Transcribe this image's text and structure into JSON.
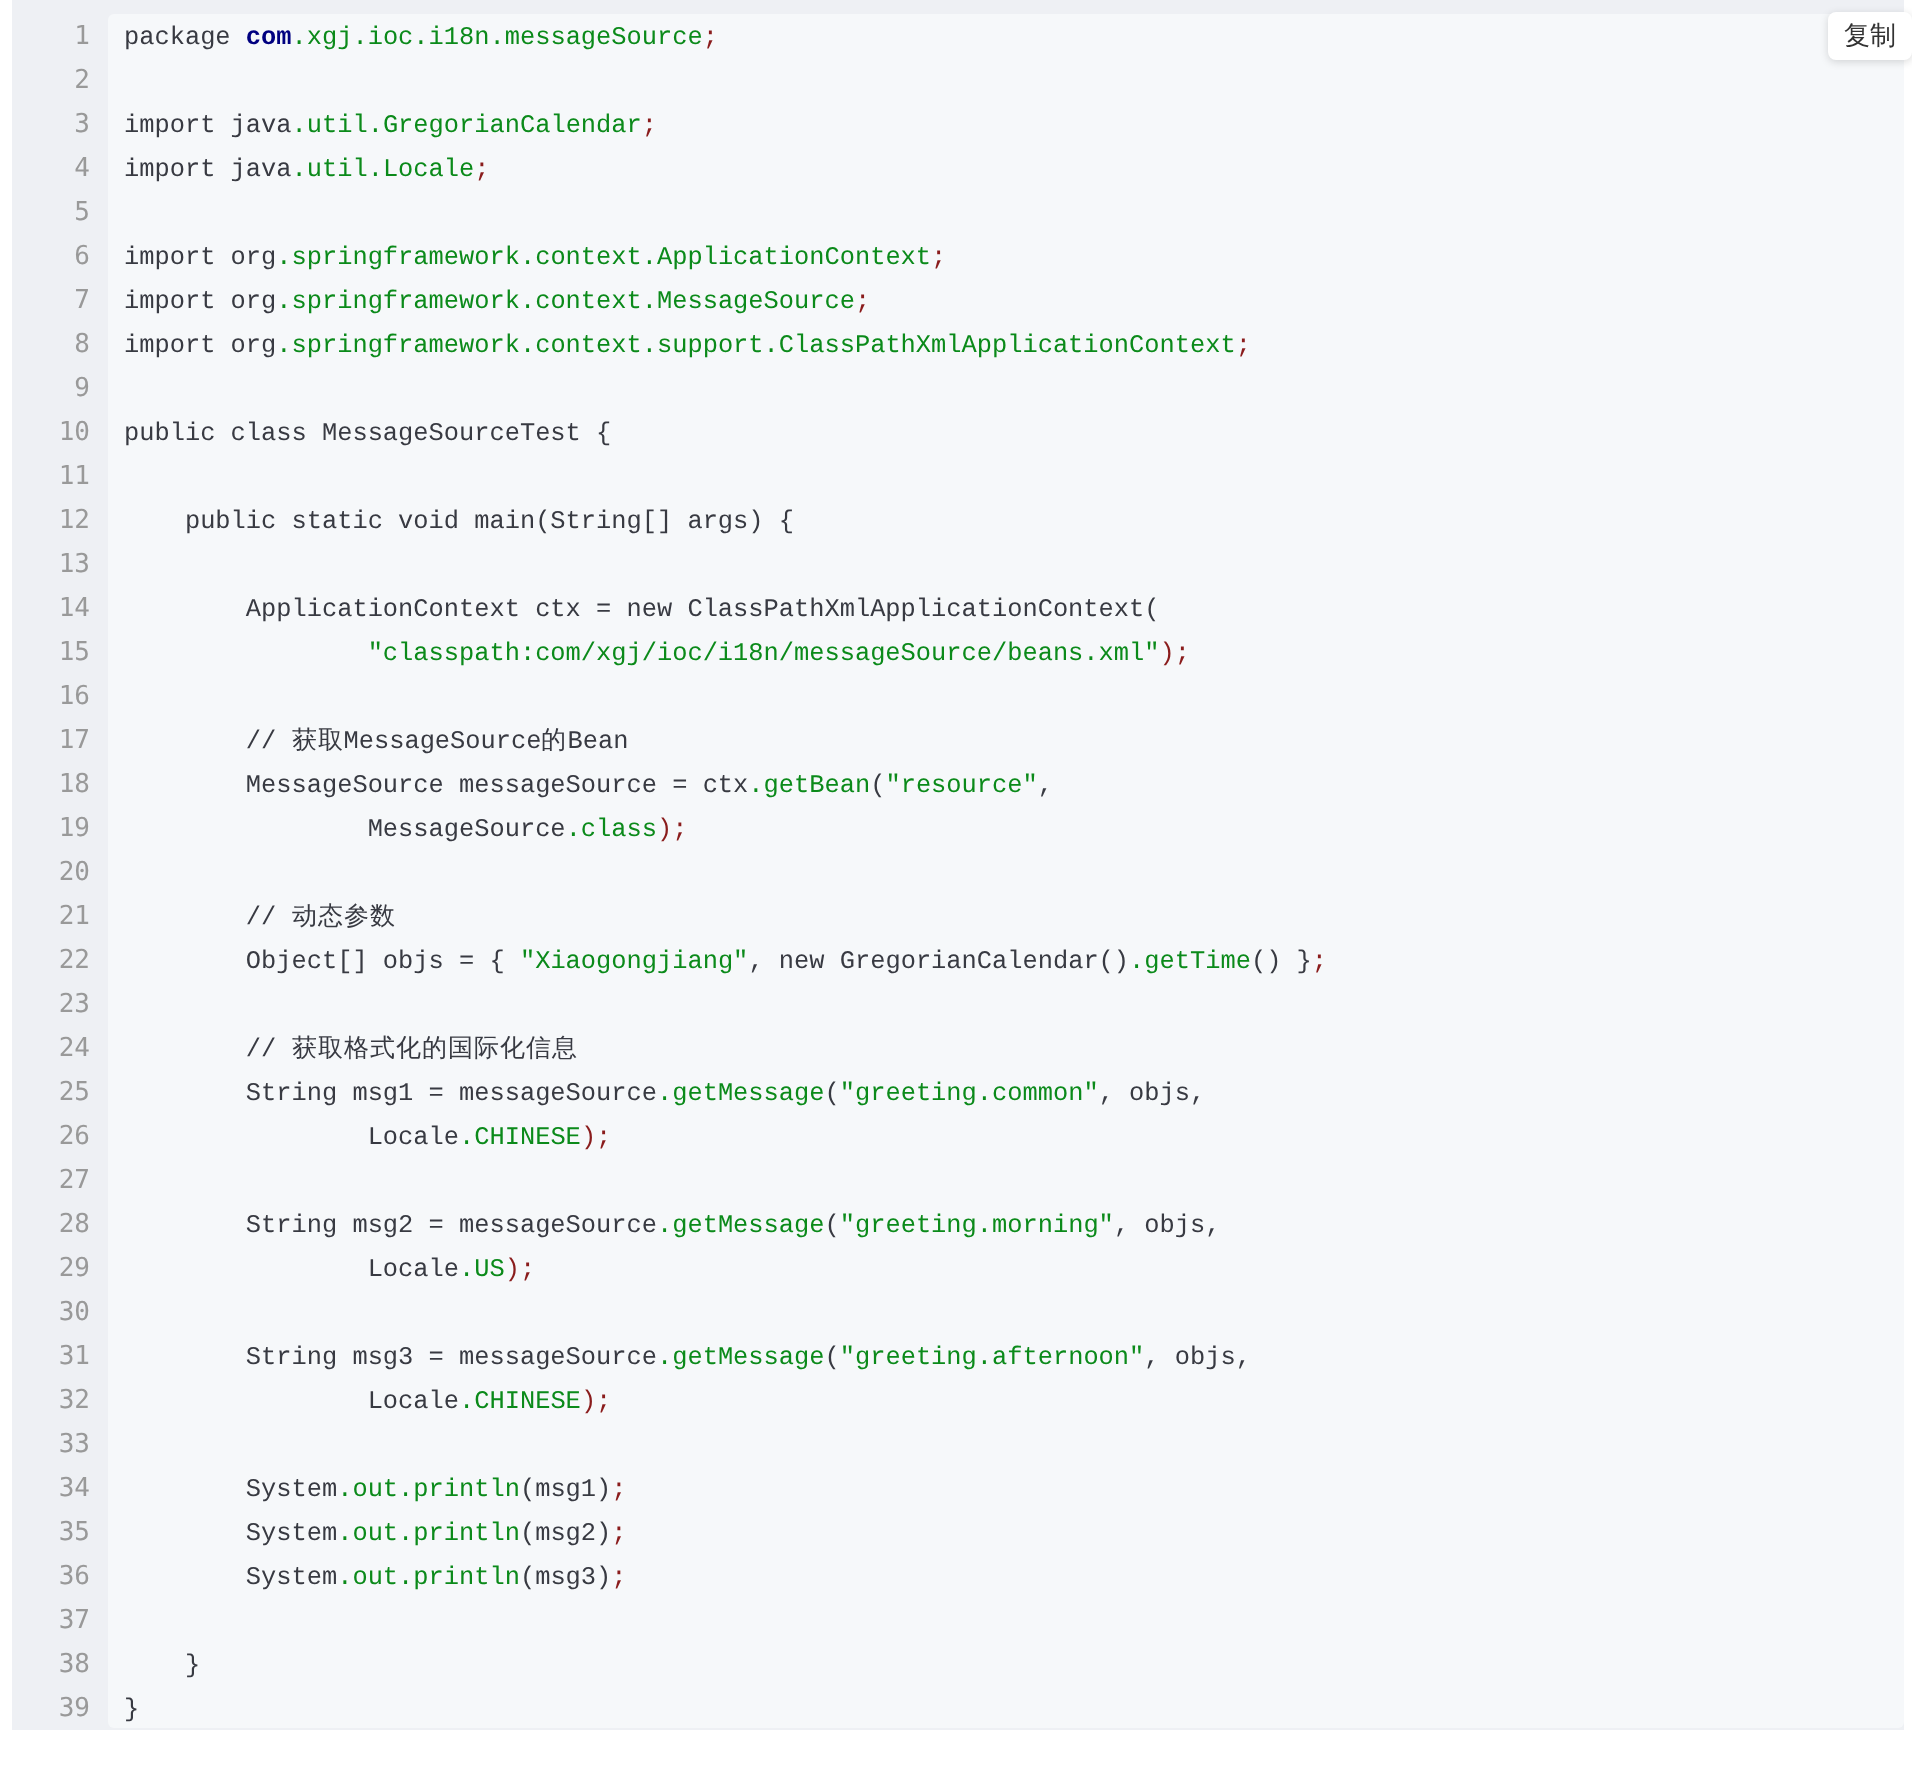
{
  "copy_button": "复制",
  "lines": [
    {
      "number": "1",
      "tokens": [
        {
          "text": "package ",
          "kind": "plain"
        },
        {
          "text": "com",
          "kind": "keyword"
        },
        {
          "text": ".xgj.ioc.i18n.messageSource",
          "kind": "member"
        },
        {
          "text": ";",
          "kind": "punct"
        }
      ]
    },
    {
      "number": "2"
    },
    {
      "number": "3",
      "tokens": [
        {
          "text": "import java",
          "kind": "plain"
        },
        {
          "text": ".util.GregorianCalendar",
          "kind": "member"
        },
        {
          "text": ";",
          "kind": "punct"
        }
      ]
    },
    {
      "number": "4",
      "tokens": [
        {
          "text": "import java",
          "kind": "plain"
        },
        {
          "text": ".util.Locale",
          "kind": "member"
        },
        {
          "text": ";",
          "kind": "punct"
        }
      ]
    },
    {
      "number": "5"
    },
    {
      "number": "6",
      "tokens": [
        {
          "text": "import org",
          "kind": "plain"
        },
        {
          "text": ".springframework.context.ApplicationContext",
          "kind": "member"
        },
        {
          "text": ";",
          "kind": "punct"
        }
      ]
    },
    {
      "number": "7",
      "tokens": [
        {
          "text": "import org",
          "kind": "plain"
        },
        {
          "text": ".springframework.context.MessageSource",
          "kind": "member"
        },
        {
          "text": ";",
          "kind": "punct"
        }
      ]
    },
    {
      "number": "8",
      "tokens": [
        {
          "text": "import org",
          "kind": "plain"
        },
        {
          "text": ".springframework.context.support.ClassPathXmlApplicationContext",
          "kind": "member"
        },
        {
          "text": ";",
          "kind": "punct"
        }
      ]
    },
    {
      "number": "9"
    },
    {
      "number": "10",
      "tokens": [
        {
          "text": "public class MessageSourceTest {",
          "kind": "plain"
        }
      ]
    },
    {
      "number": "11"
    },
    {
      "number": "12",
      "tokens": [
        {
          "text": "    public static void main(String[] args) {",
          "kind": "plain"
        }
      ]
    },
    {
      "number": "13"
    },
    {
      "number": "14",
      "tokens": [
        {
          "text": "        ApplicationContext ctx = new ClassPathXmlApplicationContext(",
          "kind": "plain"
        }
      ]
    },
    {
      "number": "15",
      "tokens": [
        {
          "text": "                \"classpath:com/xgj/ioc/i18n/messageSource/beans.xml\"",
          "kind": "member"
        },
        {
          "text": ");",
          "kind": "punct"
        }
      ]
    },
    {
      "number": "16"
    },
    {
      "number": "17",
      "tokens": [
        {
          "text": "        // 获取MessageSource的Bean",
          "kind": "plain"
        }
      ]
    },
    {
      "number": "18",
      "tokens": [
        {
          "text": "        MessageSource messageSource = ctx",
          "kind": "plain"
        },
        {
          "text": ".getBean",
          "kind": "member"
        },
        {
          "text": "(",
          "kind": "plain"
        },
        {
          "text": "\"resource\"",
          "kind": "member"
        },
        {
          "text": ",",
          "kind": "plain"
        }
      ]
    },
    {
      "number": "19",
      "tokens": [
        {
          "text": "                MessageSource",
          "kind": "plain"
        },
        {
          "text": ".class",
          "kind": "member"
        },
        {
          "text": ");",
          "kind": "punct"
        }
      ]
    },
    {
      "number": "20"
    },
    {
      "number": "21",
      "tokens": [
        {
          "text": "        // 动态参数",
          "kind": "plain"
        }
      ]
    },
    {
      "number": "22",
      "tokens": [
        {
          "text": "        Object[] objs = { ",
          "kind": "plain"
        },
        {
          "text": "\"Xiaogongjiang\"",
          "kind": "member"
        },
        {
          "text": ", new GregorianCalendar()",
          "kind": "plain"
        },
        {
          "text": ".getTime",
          "kind": "member"
        },
        {
          "text": "() }",
          "kind": "plain"
        },
        {
          "text": ";",
          "kind": "punct"
        }
      ]
    },
    {
      "number": "23"
    },
    {
      "number": "24",
      "tokens": [
        {
          "text": "        // 获取格式化的国际化信息",
          "kind": "plain"
        }
      ]
    },
    {
      "number": "25",
      "tokens": [
        {
          "text": "        String msg1 = messageSource",
          "kind": "plain"
        },
        {
          "text": ".getMessage",
          "kind": "member"
        },
        {
          "text": "(",
          "kind": "plain"
        },
        {
          "text": "\"greeting.common\"",
          "kind": "member"
        },
        {
          "text": ", objs,",
          "kind": "plain"
        }
      ]
    },
    {
      "number": "26",
      "tokens": [
        {
          "text": "                Locale",
          "kind": "plain"
        },
        {
          "text": ".CHINESE",
          "kind": "member"
        },
        {
          "text": ");",
          "kind": "punct"
        }
      ]
    },
    {
      "number": "27"
    },
    {
      "number": "28",
      "tokens": [
        {
          "text": "        String msg2 = messageSource",
          "kind": "plain"
        },
        {
          "text": ".getMessage",
          "kind": "member"
        },
        {
          "text": "(",
          "kind": "plain"
        },
        {
          "text": "\"greeting.morning\"",
          "kind": "member"
        },
        {
          "text": ", objs,",
          "kind": "plain"
        }
      ]
    },
    {
      "number": "29",
      "tokens": [
        {
          "text": "                Locale",
          "kind": "plain"
        },
        {
          "text": ".US",
          "kind": "member"
        },
        {
          "text": ");",
          "kind": "punct"
        }
      ]
    },
    {
      "number": "30"
    },
    {
      "number": "31",
      "tokens": [
        {
          "text": "        String msg3 = messageSource",
          "kind": "plain"
        },
        {
          "text": ".getMessage",
          "kind": "member"
        },
        {
          "text": "(",
          "kind": "plain"
        },
        {
          "text": "\"greeting.afternoon\"",
          "kind": "member"
        },
        {
          "text": ", objs,",
          "kind": "plain"
        }
      ]
    },
    {
      "number": "32",
      "tokens": [
        {
          "text": "                Locale",
          "kind": "plain"
        },
        {
          "text": ".CHINESE",
          "kind": "member"
        },
        {
          "text": ");",
          "kind": "punct"
        }
      ]
    },
    {
      "number": "33"
    },
    {
      "number": "34",
      "tokens": [
        {
          "text": "        System",
          "kind": "plain"
        },
        {
          "text": ".out.println",
          "kind": "member"
        },
        {
          "text": "(msg1)",
          "kind": "plain"
        },
        {
          "text": ";",
          "kind": "punct"
        }
      ]
    },
    {
      "number": "35",
      "tokens": [
        {
          "text": "        System",
          "kind": "plain"
        },
        {
          "text": ".out.println",
          "kind": "member"
        },
        {
          "text": "(msg2)",
          "kind": "plain"
        },
        {
          "text": ";",
          "kind": "punct"
        }
      ]
    },
    {
      "number": "36",
      "tokens": [
        {
          "text": "        System",
          "kind": "plain"
        },
        {
          "text": ".out.println",
          "kind": "member"
        },
        {
          "text": "(msg3)",
          "kind": "plain"
        },
        {
          "text": ";",
          "kind": "punct"
        }
      ]
    },
    {
      "number": "37"
    },
    {
      "number": "38",
      "tokens": [
        {
          "text": "    }",
          "kind": "plain"
        }
      ]
    },
    {
      "number": "39",
      "tokens": [
        {
          "text": "}",
          "kind": "plain"
        }
      ]
    }
  ]
}
